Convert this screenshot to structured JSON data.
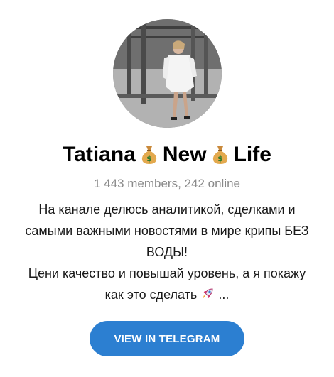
{
  "channel": {
    "title_parts": [
      "Tatiana",
      "New",
      "Life"
    ],
    "title_icon": "money-bag-icon",
    "members_text": "1 443 members, 242 online",
    "description": {
      "line1": "На канале делюсь аналитикой, сделками и",
      "line2": "самыми важными новостями в мире крипы БЕЗ",
      "line3": "ВОДЫ!",
      "line4": "Цени качество и повышай уровень, а я покажу",
      "line5_text": "как это сделать",
      "line5_icon": "rocket-icon",
      "line5_suffix": " ..."
    }
  },
  "cta": {
    "label": "VIEW IN TELEGRAM"
  },
  "colors": {
    "accent": "#2c7fd1",
    "muted_text": "#8a8a8a"
  }
}
